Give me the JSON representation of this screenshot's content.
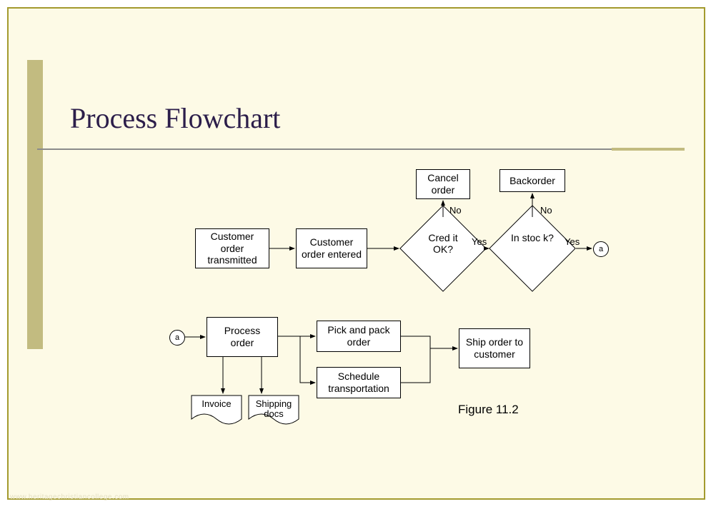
{
  "title": "Process Flowchart",
  "nodes": {
    "cancel": "Cancel order",
    "backorder": "Backorder",
    "cust_tx": "Customer order transmitted",
    "cust_ent": "Customer order entered",
    "credit_ok": "Cred it OK?",
    "in_stock": "In stoc k?",
    "process": "Process order",
    "pick": "Pick and pack order",
    "schedule": "Schedule transportation",
    "ship": "Ship order to customer",
    "invoice": "Invoice",
    "ship_docs": "Shipping docs"
  },
  "labels": {
    "no1": "No",
    "no2": "No",
    "yes1": "Yes",
    "yes2": "Yes",
    "connA_top": "a",
    "connA_bot": "a"
  },
  "caption": "Figure 11.2",
  "watermark": "www.heritagechristiancollege.com"
}
